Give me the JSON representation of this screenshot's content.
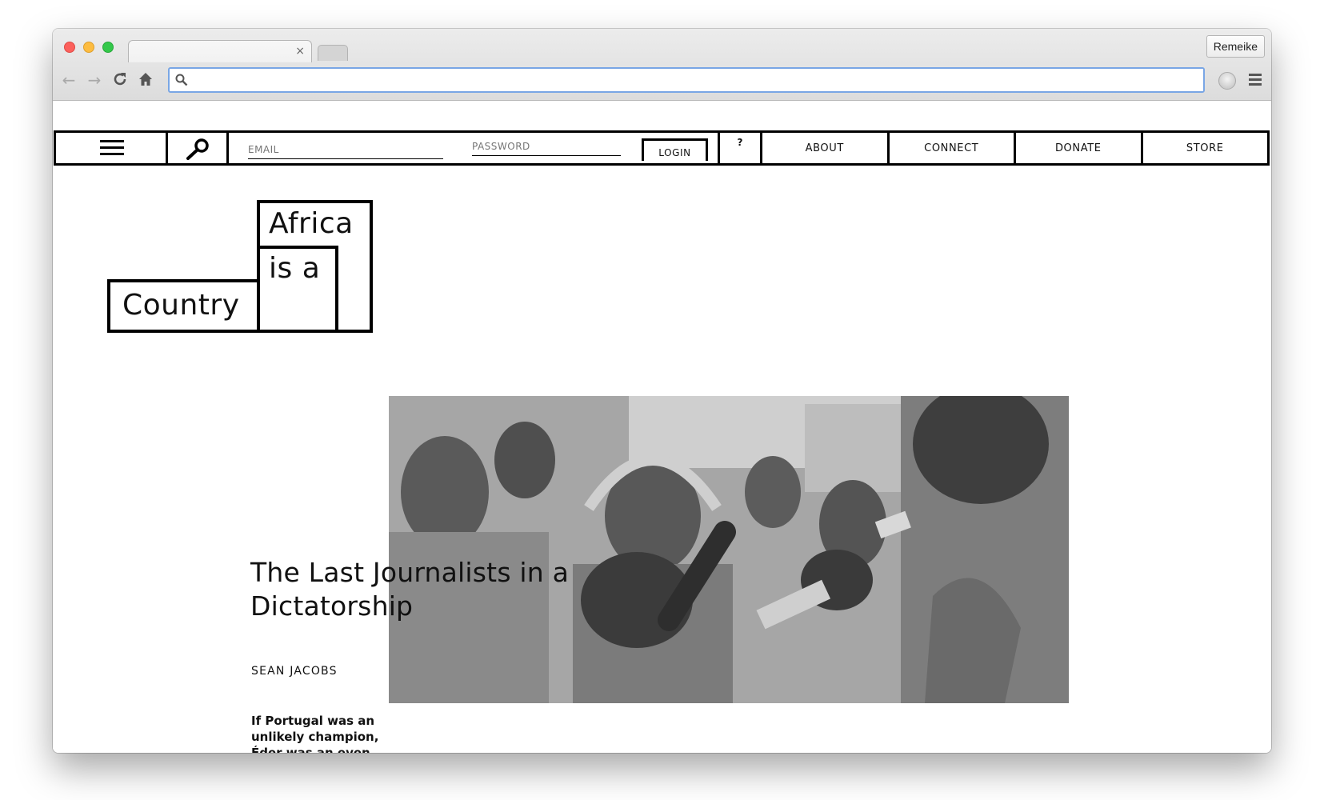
{
  "browser": {
    "tab_close": "×",
    "profile_name": "Remeike",
    "address_value": ""
  },
  "site": {
    "login": {
      "email_placeholder": "EMAIL",
      "password_placeholder": "PASSWORD",
      "login_label": "LOGIN"
    },
    "help_label": "?",
    "nav_links": [
      "ABOUT",
      "CONNECT",
      "DONATE",
      "STORE"
    ],
    "logo": {
      "line1": "Africa",
      "line2": "is a",
      "line3": "Country"
    },
    "article": {
      "title": "The Last Journalists in a Dictatorship",
      "author": "SEAN JACOBS",
      "excerpt": "If Portugal was an unlikely champion, Éder was an even"
    }
  },
  "colors": {
    "omnibox_focus": "#79a6e5",
    "site_text": "#111111",
    "site_border": "#000000"
  }
}
